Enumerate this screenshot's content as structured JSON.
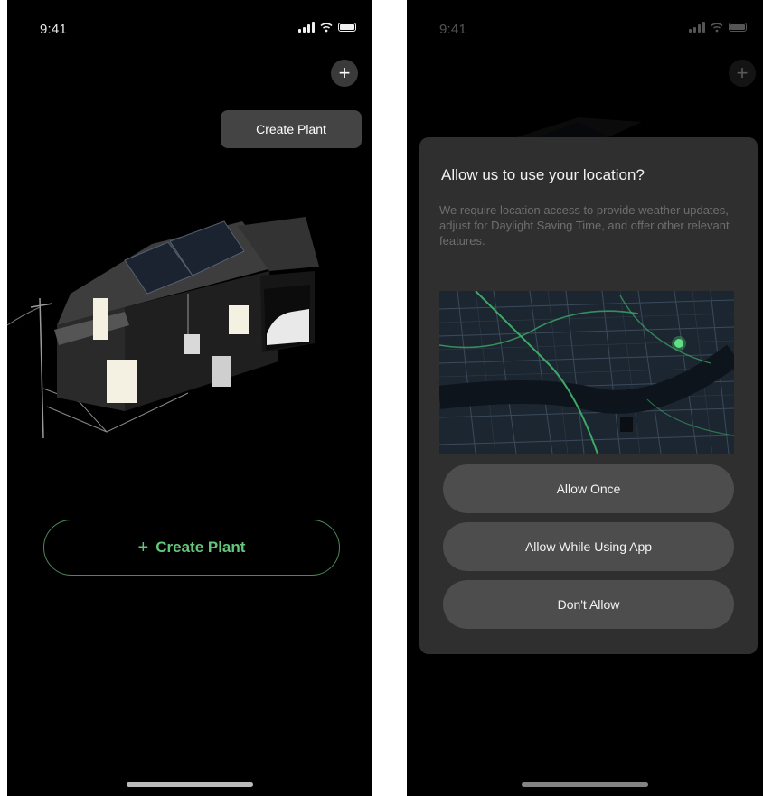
{
  "left_screen": {
    "status_bar": {
      "time": "9:41"
    },
    "header": {
      "add_button_glyph": "+"
    },
    "tooltip": {
      "label": "Create Plant"
    },
    "create_plant": {
      "icon": "+",
      "label": "Create Plant"
    },
    "colors": {
      "accent": "#63c779",
      "outline": "#4a8a5a",
      "background": "#000000"
    }
  },
  "right_screen": {
    "status_bar": {
      "time": "9:41"
    },
    "header": {
      "add_button_glyph": "+"
    },
    "location_dialog": {
      "title": "Allow us to use your location?",
      "description": "We require location access to provide weather updates, adjust for Daylight Saving Time, and offer other relevant features.",
      "buttons": {
        "allow_once": "Allow Once",
        "allow_while_using": "Allow While Using App",
        "dont_allow": "Don't Allow"
      }
    }
  }
}
